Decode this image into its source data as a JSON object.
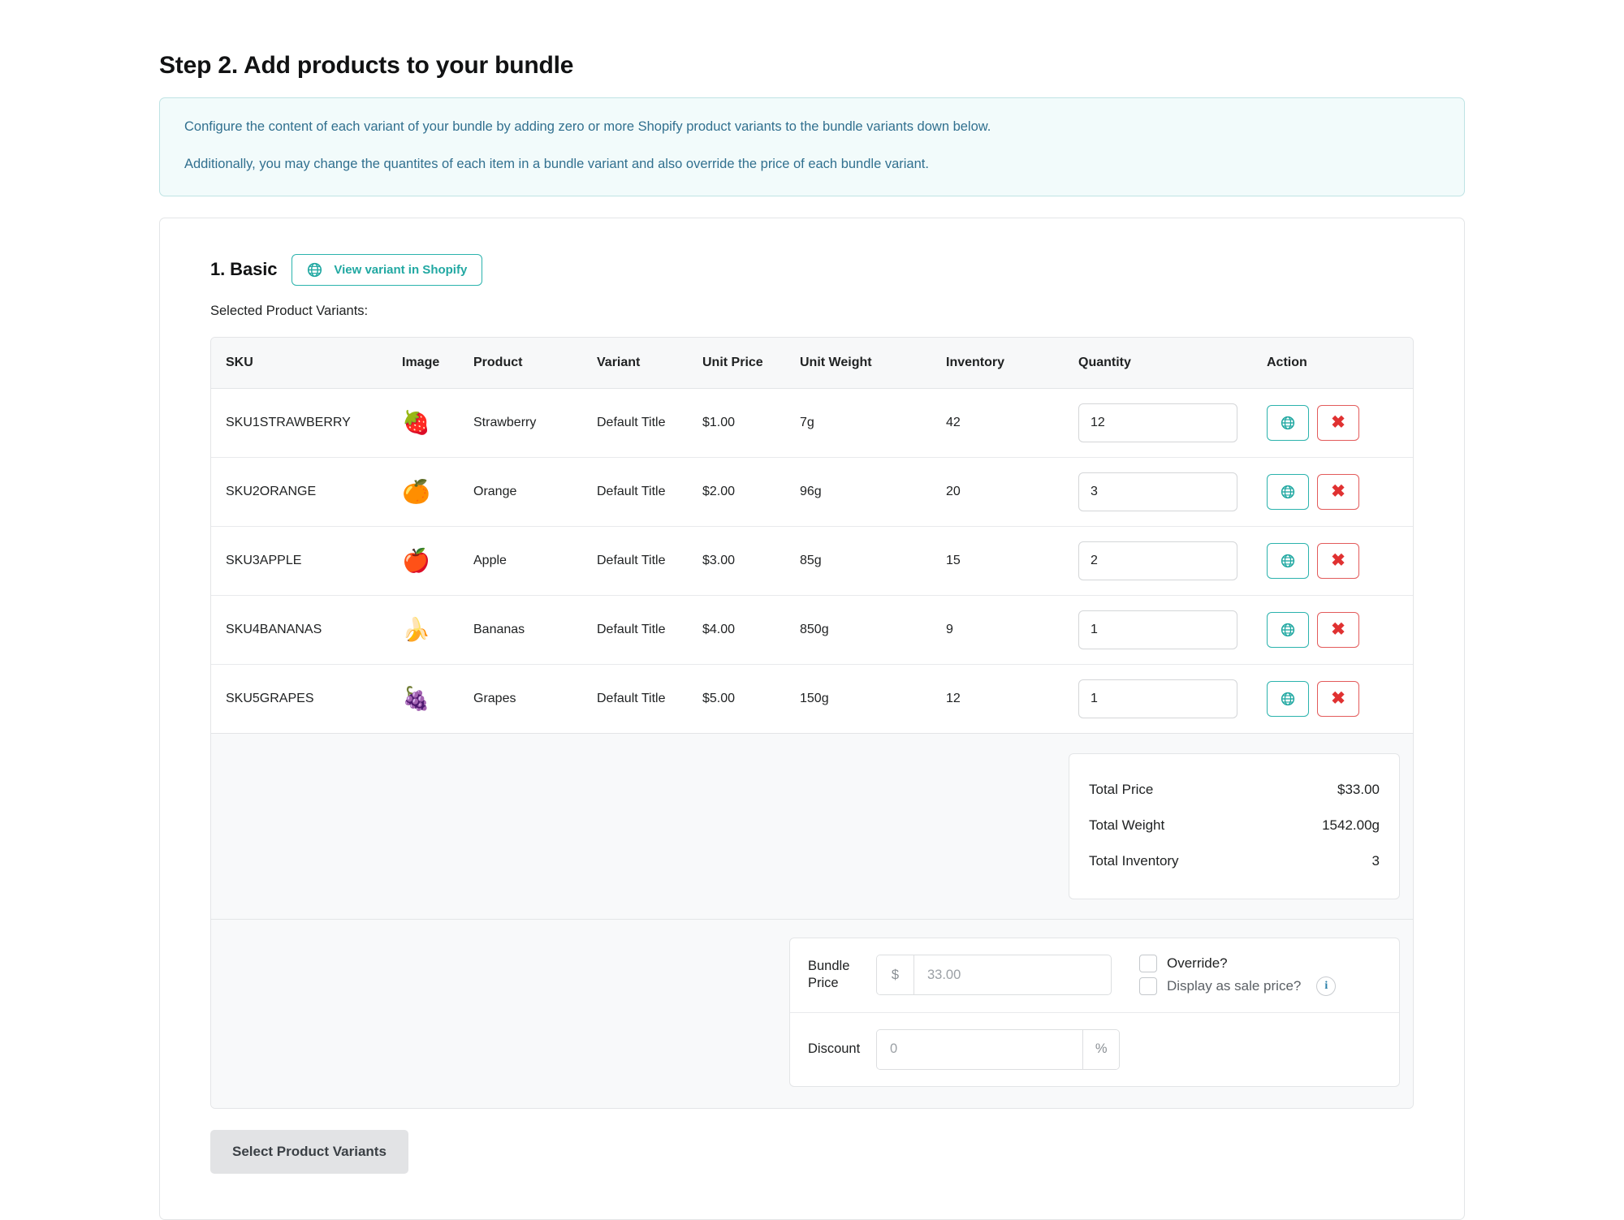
{
  "page": {
    "step_title": "Step 2. Add products to your bundle"
  },
  "info_banner": {
    "line1": "Configure the content of each variant of your bundle by adding zero or more Shopify product variants to the bundle variants down below.",
    "line2": "Additionally, you may change the quantites of each item in a bundle variant and also override the price of each bundle variant."
  },
  "variant": {
    "title": "1. Basic",
    "view_button_label": "View variant in Shopify",
    "view_button_icon": "globe-icon",
    "selected_label": "Selected Product Variants:"
  },
  "table": {
    "headers": [
      "SKU",
      "Image",
      "Product",
      "Variant",
      "Unit Price",
      "Unit Weight",
      "Inventory",
      "Quantity",
      "Action"
    ],
    "rows": [
      {
        "sku": "SKU1STRAWBERRY",
        "image": "🍓",
        "image_name": "strawberry-image",
        "product": "Strawberry",
        "variant": "Default Title",
        "unit_price": "$1.00",
        "unit_weight": "7g",
        "inventory": "42",
        "quantity": "12",
        "view_icon": "globe-icon",
        "remove_icon": "close-icon"
      },
      {
        "sku": "SKU2ORANGE",
        "image": "🍊",
        "image_name": "orange-image",
        "product": "Orange",
        "variant": "Default Title",
        "unit_price": "$2.00",
        "unit_weight": "96g",
        "inventory": "20",
        "quantity": "3",
        "view_icon": "globe-icon",
        "remove_icon": "close-icon"
      },
      {
        "sku": "SKU3APPLE",
        "image": "🍎",
        "image_name": "apple-image",
        "product": "Apple",
        "variant": "Default Title",
        "unit_price": "$3.00",
        "unit_weight": "85g",
        "inventory": "15",
        "quantity": "2",
        "view_icon": "globe-icon",
        "remove_icon": "close-icon"
      },
      {
        "sku": "SKU4BANANAS",
        "image": "🍌",
        "image_name": "bananas-image",
        "product": "Bananas",
        "variant": "Default Title",
        "unit_price": "$4.00",
        "unit_weight": "850g",
        "inventory": "9",
        "quantity": "1",
        "view_icon": "globe-icon",
        "remove_icon": "close-icon"
      },
      {
        "sku": "SKU5GRAPES",
        "image": "🍇",
        "image_name": "grapes-image",
        "product": "Grapes",
        "variant": "Default Title",
        "unit_price": "$5.00",
        "unit_weight": "150g",
        "inventory": "12",
        "quantity": "1",
        "view_icon": "globe-icon",
        "remove_icon": "close-icon"
      }
    ]
  },
  "totals": {
    "price_label": "Total Price",
    "price_value": "$33.00",
    "weight_label": "Total Weight",
    "weight_value": "1542.00g",
    "inventory_label": "Total Inventory",
    "inventory_value": "3"
  },
  "pricing": {
    "bundle_price_label": "Bundle Price",
    "currency_symbol": "$",
    "bundle_price_value": "",
    "bundle_price_placeholder": "33.00",
    "discount_label": "Discount",
    "discount_value": "",
    "discount_placeholder": "0",
    "percent_symbol": "%",
    "override_label": "Override?",
    "sale_price_label": "Display as sale price?",
    "info_icon": "info-icon",
    "info_glyph": "i"
  },
  "footer": {
    "select_button_label": "Select Product Variants"
  },
  "colors": {
    "accent_teal": "#2bb3ad",
    "danger_red": "#e03131",
    "banner_text": "#31708f",
    "banner_bg": "#f2fbfb",
    "banner_border": "#bfe3e4",
    "info_blue": "#2a7fa8"
  }
}
